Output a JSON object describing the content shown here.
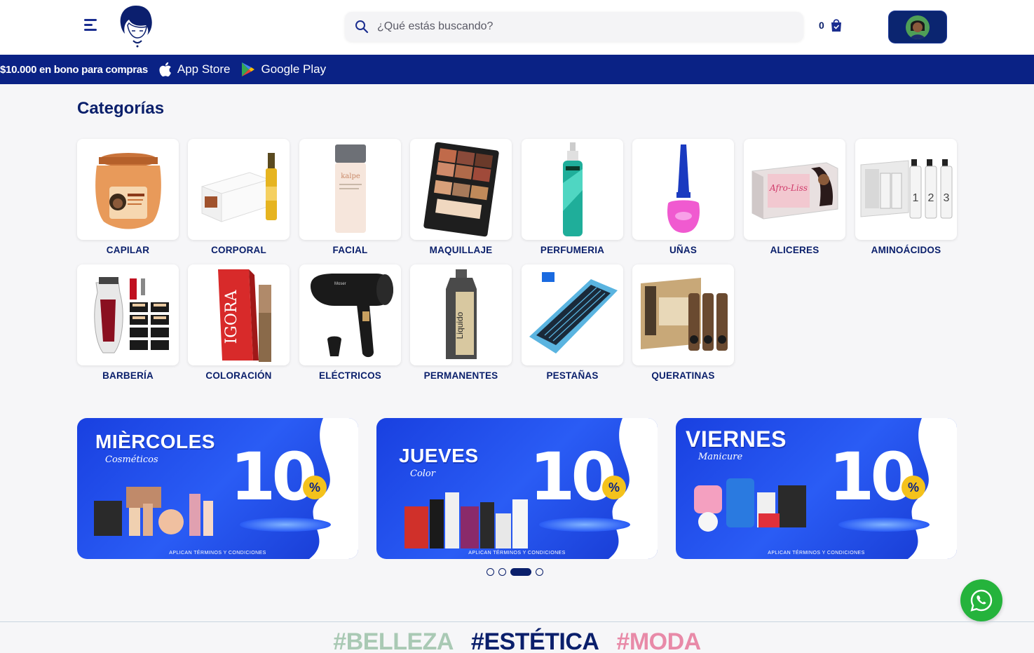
{
  "header": {
    "search_placeholder": "¿Qué estás buscando?",
    "cart_count": "0"
  },
  "promo_bar": {
    "text": "$10.000 en bono para compras",
    "app_store": "App Store",
    "google_play": "Google Play"
  },
  "categories": {
    "title": "Categorías",
    "items": [
      {
        "label": "CAPILAR",
        "icon": "hair-cream-jar"
      },
      {
        "label": "CORPORAL",
        "icon": "body-ampoule"
      },
      {
        "label": "FACIAL",
        "icon": "facial-bottle"
      },
      {
        "label": "MAQUILLAJE",
        "icon": "eyeshadow-palette"
      },
      {
        "label": "PERFUMERIA",
        "icon": "perfume-spray"
      },
      {
        "label": "UÑAS",
        "icon": "nail-polish"
      },
      {
        "label": "ALICERES",
        "icon": "relaxer-kit"
      },
      {
        "label": "AMINOÁCIDOS",
        "icon": "amino-bottles"
      },
      {
        "label": "BARBERÍA",
        "icon": "hair-clipper"
      },
      {
        "label": "COLORACIÓN",
        "icon": "hair-dye-box"
      },
      {
        "label": "ELÉCTRICOS",
        "icon": "hair-dryer"
      },
      {
        "label": "PERMANENTES",
        "icon": "perm-bottle"
      },
      {
        "label": "PESTAÑAS",
        "icon": "eyelash-tray"
      },
      {
        "label": "QUERATINAS",
        "icon": "keratin-kit"
      }
    ]
  },
  "banners": [
    {
      "day": "MIÈRCOLES",
      "subtitle": "Cosméticos",
      "percent": "10",
      "badge": "%",
      "terms": "APLICAN TÉRMINOS Y CONDICIONES"
    },
    {
      "day": "JUEVES",
      "subtitle": "Color",
      "percent": "10",
      "badge": "%",
      "terms": "APLICAN TÉRMINOS Y CONDICIONES"
    },
    {
      "day": "VIERNES",
      "subtitle": "Manicure",
      "percent": "10",
      "badge": "%",
      "terms": "APLICAN TÉRMINOS Y CONDICIONES"
    }
  ],
  "carousel": {
    "active_index": 2,
    "count": 4
  },
  "hashtags": [
    {
      "text": "#BELLEZA",
      "color": "#a9c9b4"
    },
    {
      "text": "#ESTÉTICA",
      "color": "#0a1f6b"
    },
    {
      "text": "#MODA",
      "color": "#e88aa8"
    }
  ],
  "colors": {
    "brand_navy": "#0a2285",
    "accent_blue": "#2a5cf5",
    "whatsapp_green": "#25b33c"
  }
}
